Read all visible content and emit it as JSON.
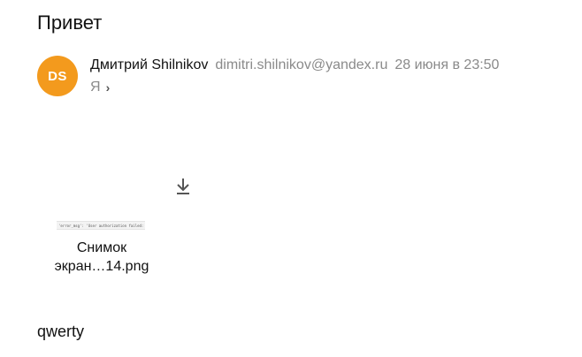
{
  "message": {
    "subject": "Привет",
    "body": "qwerty"
  },
  "sender": {
    "initials": "DS",
    "name": "Дмитрий Shilnikov",
    "email": "dimitri.shilnikov@yandex.ru",
    "date": "28 июня в 23:50",
    "avatar_color": "#f39a1d"
  },
  "recipient": {
    "label": "Я",
    "chevron": "›"
  },
  "attachment": {
    "name_line1": "Снимок",
    "name_line2": "экран…14.png",
    "thumbnail_text": "'error_msg': 'User authorization failed:",
    "download_icon": "download-icon"
  }
}
